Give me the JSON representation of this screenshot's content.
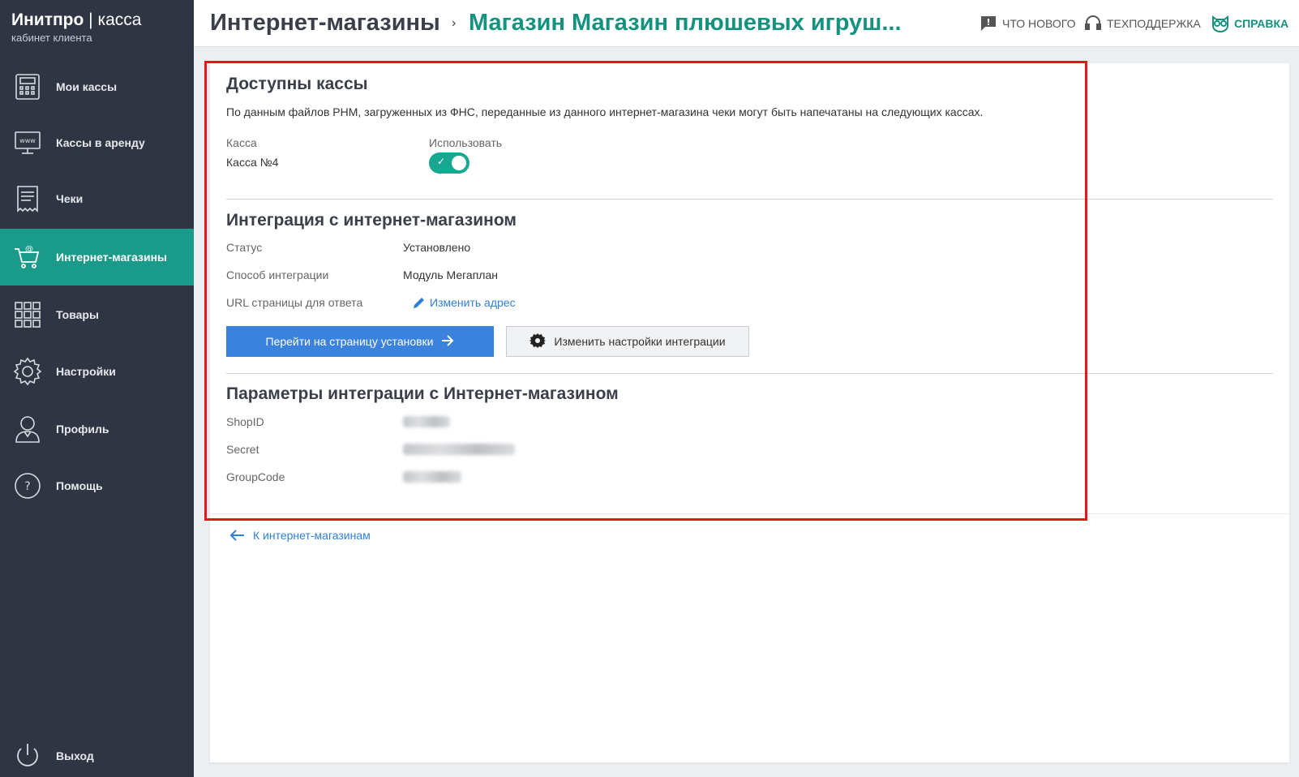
{
  "brand": {
    "title_bold": "Инитпро",
    "title_sep": " | ",
    "title_rest": "касса",
    "subtitle": "кабинет клиента"
  },
  "sidebar": {
    "items": [
      {
        "label": "Мои кассы",
        "icon": "cash-register-icon"
      },
      {
        "label": "Кассы в аренду",
        "icon": "www-monitor-icon"
      },
      {
        "label": "Чеки",
        "icon": "receipt-icon"
      },
      {
        "label": "Интернет-магазины",
        "icon": "shopping-cart-at-icon",
        "active": true
      },
      {
        "label": "Товары",
        "icon": "grid-icon"
      },
      {
        "label": "Настройки",
        "icon": "gear-icon"
      },
      {
        "label": "Профиль",
        "icon": "user-icon"
      },
      {
        "label": "Помощь",
        "icon": "question-icon"
      }
    ],
    "logout": {
      "label": "Выход",
      "icon": "power-icon"
    }
  },
  "header": {
    "crumb_root": "Интернет-магазины",
    "crumb_separator": "›",
    "crumb_current": "Магазин Магазин плюшевых игруш...",
    "links": {
      "whats_new": "Что нового",
      "support": "Техподдержка",
      "help": "Справка"
    }
  },
  "available": {
    "title": "Доступны кассы",
    "description": "По данным файлов РНМ, загруженных из ФНС, переданные из данного интернет-магазина чеки могут быть напечатаны на следующих кассах.",
    "col_kassa": "Касса",
    "col_use": "Использовать",
    "kassa_name": "Касса №4",
    "use_enabled": true
  },
  "integration": {
    "title": "Интеграция с интернет-магазином",
    "status_label": "Статус",
    "status_value": "Установлено",
    "method_label": "Способ интеграции",
    "method_value": "Модуль Мегаплан",
    "url_label": "URL страницы для ответа",
    "change_address": "Изменить адрес",
    "btn_install": "Перейти на страницу установки",
    "btn_settings": "Изменить настройки интеграции"
  },
  "params": {
    "title": "Параметры интеграции с Интернет-магазином",
    "shopid_label": "ShopID",
    "secret_label": "Secret",
    "groupcode_label": "GroupCode"
  },
  "back_link": "К интернет-магазинам",
  "colors": {
    "sidebar_bg": "#2f3542",
    "accent": "#13927f",
    "active_item": "#1a9b8a",
    "primary_button": "#3a82db",
    "link": "#2f7fd8",
    "highlight_frame": "#e8141c"
  }
}
